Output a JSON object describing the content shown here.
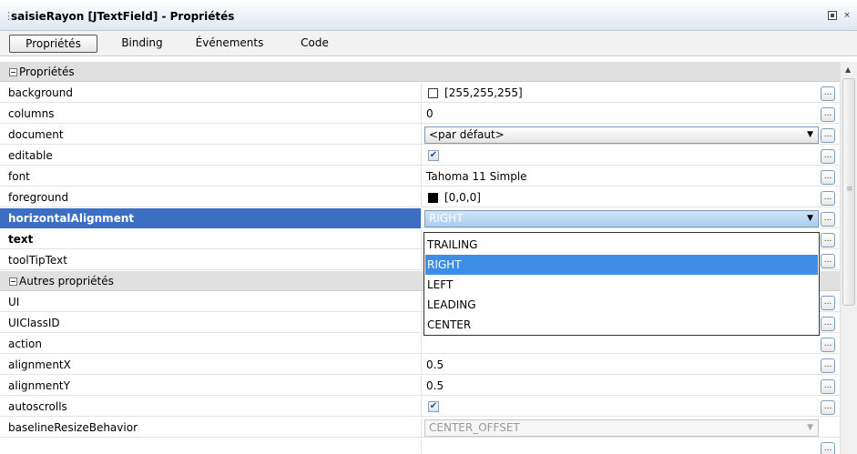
{
  "window": {
    "title": "saisieRayon [JTextField] - Propriétés",
    "close_glyph": "×"
  },
  "tabs": [
    {
      "label": "Propriétés",
      "active": true
    },
    {
      "label": "Binding"
    },
    {
      "label": "Événements"
    },
    {
      "label": "Code"
    }
  ],
  "sections": {
    "main": "Propriétés",
    "other": "Autres propriétés"
  },
  "properties": {
    "background": {
      "name": "background",
      "value": "[255,255,255]",
      "swatch_color": "#ffffff"
    },
    "columns": {
      "name": "columns",
      "value": "0"
    },
    "document": {
      "name": "document",
      "value": "<par défaut>"
    },
    "editable": {
      "name": "editable",
      "checked": true
    },
    "font": {
      "name": "font",
      "value": "Tahoma 11 Simple"
    },
    "foreground": {
      "name": "foreground",
      "value": "[0,0,0]",
      "swatch_color": "#000000"
    },
    "horizontalAlignment": {
      "name": "horizontalAlignment",
      "value": "RIGHT"
    },
    "text": {
      "name": "text",
      "value": ""
    },
    "toolTipText": {
      "name": "toolTipText",
      "value": ""
    },
    "UI": {
      "name": "UI",
      "value": ""
    },
    "UIClassID": {
      "name": "UIClassID",
      "value": ""
    },
    "action": {
      "name": "action",
      "value": ""
    },
    "alignmentX": {
      "name": "alignmentX",
      "value": "0.5"
    },
    "alignmentY": {
      "name": "alignmentY",
      "value": "0.5"
    },
    "autoscrolls": {
      "name": "autoscrolls",
      "checked": true
    },
    "baselineResizeBehavior": {
      "name": "baselineResizeBehavior",
      "value": "CENTER_OFFSET"
    }
  },
  "alignment_dropdown": {
    "options": [
      "TRAILING",
      "RIGHT",
      "LEFT",
      "LEADING",
      "CENTER"
    ],
    "selected": "RIGHT"
  },
  "glyphs": {
    "ellipsis": "...",
    "combo_arrow": "▼",
    "check": "✔",
    "scroll_up": "▲",
    "scroll_grip": "≡"
  },
  "colors": {
    "selection": "#3a6fc1",
    "dropdown_highlight": "#3f8ee6",
    "section_background": "#e0e0e0"
  }
}
